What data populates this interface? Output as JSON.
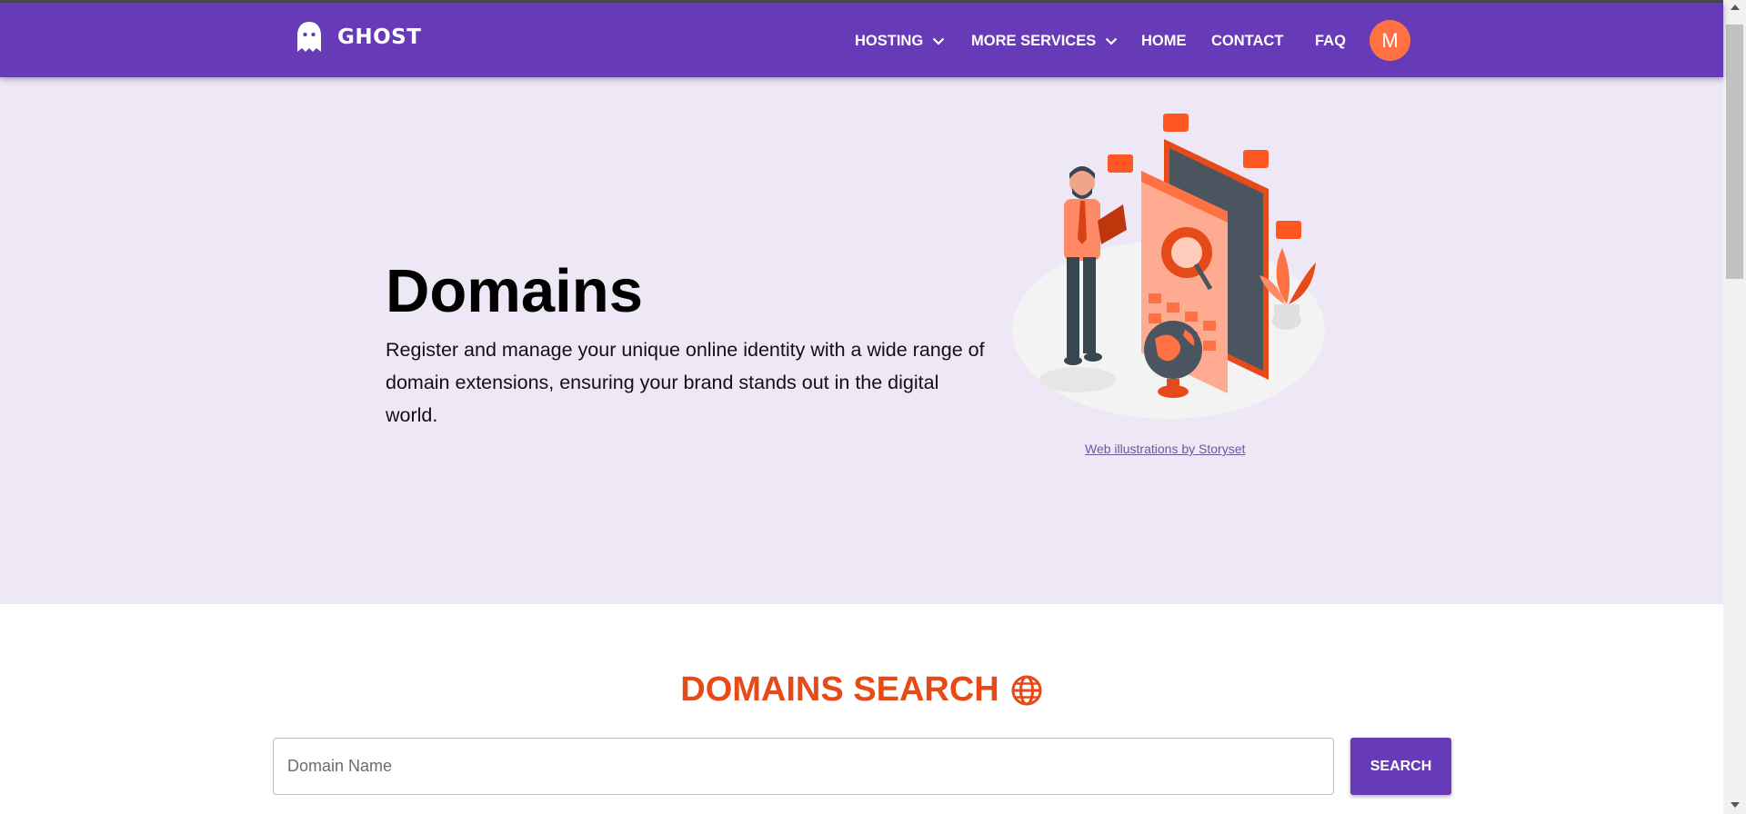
{
  "brand": {
    "name": "GHOST",
    "logo_icon": "ghost-icon"
  },
  "nav": {
    "items": [
      {
        "label": "HOSTING",
        "has_dropdown": true
      },
      {
        "label": "MORE SERVICES",
        "has_dropdown": true
      },
      {
        "label": "HOME",
        "has_dropdown": false
      },
      {
        "label": "CONTACT",
        "has_dropdown": false
      },
      {
        "label": "FAQ",
        "has_dropdown": false
      }
    ],
    "avatar_initial": "M"
  },
  "hero": {
    "title": "Domains",
    "description": "Register and manage your unique online identity with a wide range of domain extensions, ensuring your brand stands out in the digital world.",
    "illustration_icon": "domain-illustration",
    "credit": "Web illustrations by Storyset"
  },
  "search": {
    "title": "DOMAINS SEARCH",
    "title_icon": "globe-icon",
    "input_placeholder": "Domain Name",
    "input_value": "",
    "button_label": "SEARCH"
  },
  "colors": {
    "primary": "#673ab7",
    "accent": "#e64a19",
    "avatar": "#ff7043",
    "hero_bg": "#ede7f6"
  }
}
